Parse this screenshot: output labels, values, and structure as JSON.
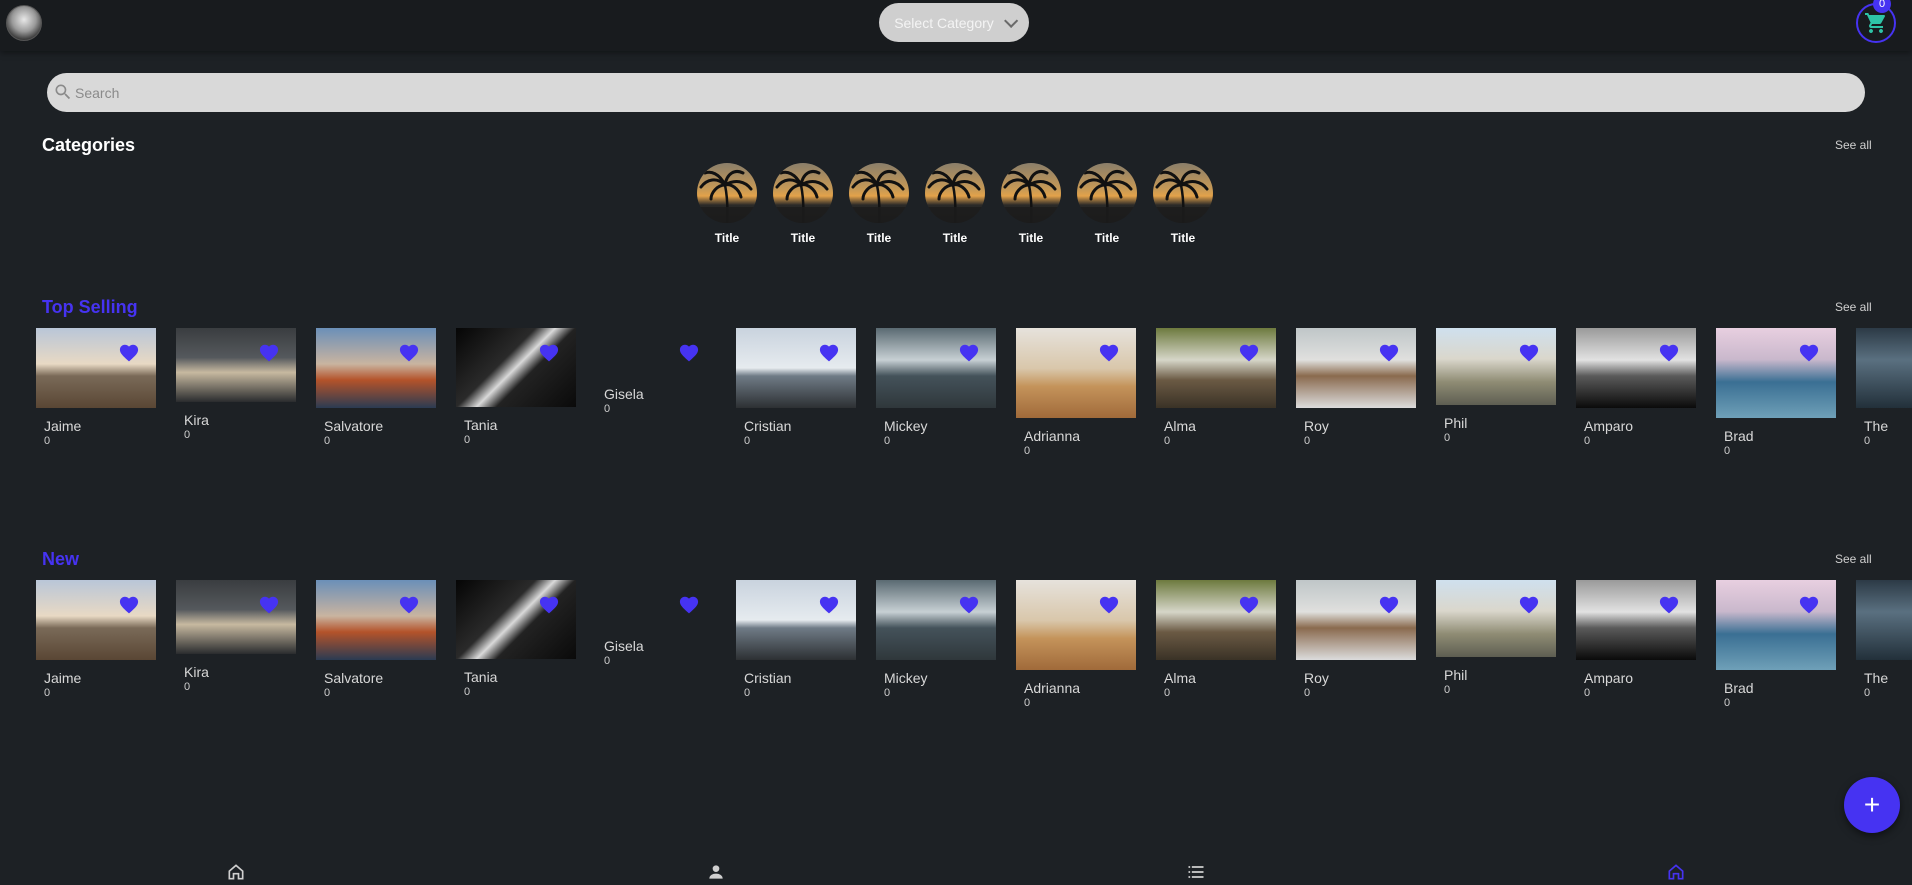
{
  "header": {
    "select_category": "Select Category",
    "cart_count": "0"
  },
  "search": {
    "placeholder": "Search"
  },
  "categories": {
    "title": "Categories",
    "see_all": "See all",
    "items": [
      "Title",
      "Title",
      "Title",
      "Title",
      "Title",
      "Title",
      "Title"
    ]
  },
  "top_selling": {
    "title": "Top Selling",
    "see_all": "See all",
    "items": [
      {
        "name": "Jaime",
        "count": "0"
      },
      {
        "name": "Kira",
        "count": "0"
      },
      {
        "name": "Salvatore",
        "count": "0"
      },
      {
        "name": "Tania",
        "count": "0"
      },
      {
        "name": "Gisela",
        "count": "0"
      },
      {
        "name": "Cristian",
        "count": "0"
      },
      {
        "name": "Mickey",
        "count": "0"
      },
      {
        "name": "Adrianna",
        "count": "0"
      },
      {
        "name": "Alma",
        "count": "0"
      },
      {
        "name": "Roy",
        "count": "0"
      },
      {
        "name": "Phil",
        "count": "0"
      },
      {
        "name": "Amparo",
        "count": "0"
      },
      {
        "name": "Brad",
        "count": "0"
      },
      {
        "name": "The",
        "count": "0"
      }
    ]
  },
  "new": {
    "title": "New",
    "see_all": "See all",
    "items": [
      {
        "name": "Jaime",
        "count": "0"
      },
      {
        "name": "Kira",
        "count": "0"
      },
      {
        "name": "Salvatore",
        "count": "0"
      },
      {
        "name": "Tania",
        "count": "0"
      },
      {
        "name": "Gisela",
        "count": "0"
      },
      {
        "name": "Cristian",
        "count": "0"
      },
      {
        "name": "Mickey",
        "count": "0"
      },
      {
        "name": "Adrianna",
        "count": "0"
      },
      {
        "name": "Alma",
        "count": "0"
      },
      {
        "name": "Roy",
        "count": "0"
      },
      {
        "name": "Phil",
        "count": "0"
      },
      {
        "name": "Amparo",
        "count": "0"
      },
      {
        "name": "Brad",
        "count": "0"
      },
      {
        "name": "The",
        "count": "0"
      }
    ]
  },
  "nav": {
    "items": [
      {
        "icon": "home-icon"
      },
      {
        "icon": "person-icon"
      },
      {
        "icon": "list-icon"
      },
      {
        "icon": "home-icon",
        "active": true
      }
    ]
  },
  "colors": {
    "accent": "#4633f2",
    "background": "#1d2125",
    "topbar": "#181b1e"
  }
}
